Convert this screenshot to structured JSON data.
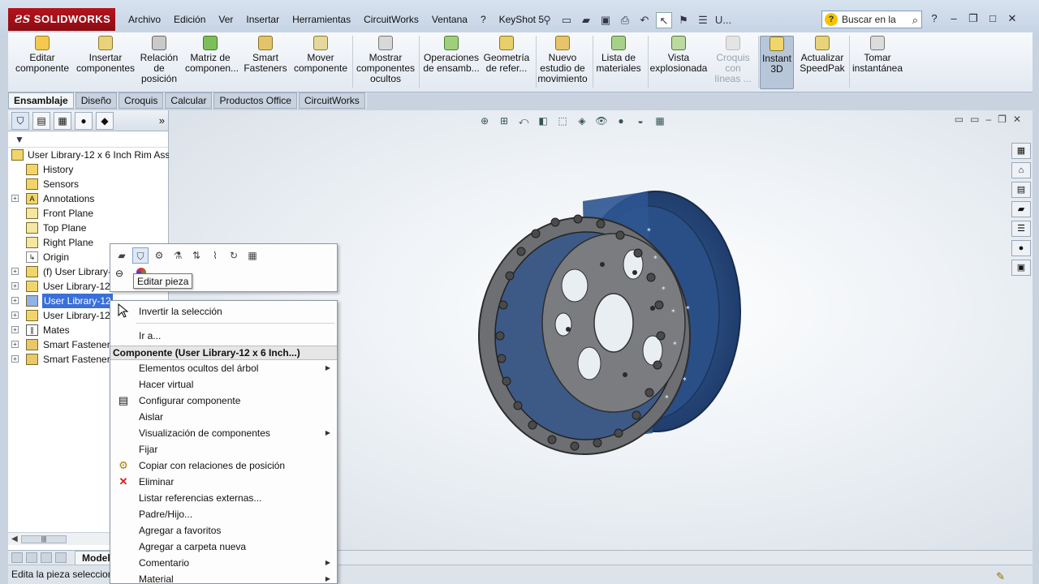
{
  "app": {
    "logo": "SOLIDWORKS",
    "menus": [
      "Archivo",
      "Edición",
      "Ver",
      "Insertar",
      "Herramientas",
      "CircuitWorks",
      "Ventana",
      "?",
      "KeyShot 5"
    ],
    "user_label": "U...",
    "search_placeholder": "Buscar en la"
  },
  "command_manager": [
    {
      "label": "Editar componente",
      "icon": "edit-component-icon"
    },
    {
      "label": "Insertar componentes",
      "icon": "insert-components-icon"
    },
    {
      "label": "Relación de posición",
      "icon": "mate-icon"
    },
    {
      "label": "Matriz de componen...",
      "icon": "component-pattern-icon"
    },
    {
      "label": "Smart Fasteners",
      "icon": "smart-fasteners-icon"
    },
    {
      "label": "Mover componente",
      "icon": "move-component-icon"
    },
    {
      "label": "Mostrar componentes ocultos",
      "icon": "show-hidden-icon"
    },
    {
      "label": "Operaciones de ensamb...",
      "icon": "assembly-features-icon"
    },
    {
      "label": "Geometría de refer...",
      "icon": "reference-geometry-icon"
    },
    {
      "label": "Nuevo estudio de movimiento",
      "icon": "motion-study-icon"
    },
    {
      "label": "Lista de materiales",
      "icon": "bom-icon"
    },
    {
      "label": "Vista explosionada",
      "icon": "exploded-view-icon"
    },
    {
      "label": "Croquis con líneas ...",
      "icon": "explode-line-icon"
    },
    {
      "label": "Instant 3D",
      "icon": "instant3d-icon"
    },
    {
      "label": "Actualizar SpeedPak",
      "icon": "speedpak-icon"
    },
    {
      "label": "Tomar instantánea",
      "icon": "snapshot-icon"
    }
  ],
  "command_tabs": [
    "Ensamblaje",
    "Diseño",
    "Croquis",
    "Calcular",
    "Productos Office",
    "CircuitWorks"
  ],
  "feature_tree": {
    "root": "User Library-12 x 6 Inch Rim Asse",
    "items": [
      {
        "label": "History",
        "icon": "history-icon"
      },
      {
        "label": "Sensors",
        "icon": "sensors-icon"
      },
      {
        "label": "Annotations",
        "icon": "annotations-icon"
      },
      {
        "label": "Front Plane",
        "icon": "plane-icon"
      },
      {
        "label": "Top Plane",
        "icon": "plane-icon"
      },
      {
        "label": "Right Plane",
        "icon": "plane-icon"
      },
      {
        "label": "Origin",
        "icon": "origin-icon"
      },
      {
        "label": "(f) User Library-",
        "icon": "part-icon"
      },
      {
        "label": "User Library-12",
        "icon": "part-icon"
      },
      {
        "label": "User Library-12",
        "icon": "part-icon"
      },
      {
        "label": "User Library-12",
        "icon": "part-icon"
      },
      {
        "label": "Mates",
        "icon": "mates-icon"
      },
      {
        "label": "Smart Fastener1",
        "icon": "folder-icon"
      },
      {
        "label": "Smart Fastener2",
        "icon": "folder-icon"
      }
    ]
  },
  "context_toolbar": {
    "tooltip": "Editar pieza"
  },
  "context_menu": {
    "items_top": [
      {
        "label": "Invertir la selección"
      },
      {
        "label": "Ir a..."
      }
    ],
    "header": "Componente (User Library-12 x 6 Inch...)",
    "items": [
      {
        "label": "Elementos ocultos del árbol",
        "submenu": true
      },
      {
        "label": "Hacer virtual"
      },
      {
        "label": "Configurar componente",
        "icon": "configure-icon"
      },
      {
        "label": "Aislar"
      },
      {
        "label": "Visualización de componentes",
        "submenu": true
      },
      {
        "label": "Fijar"
      },
      {
        "label": "Copiar con relaciones de posición",
        "icon": "copy-mates-icon"
      },
      {
        "label": "Eliminar",
        "icon": "delete-icon"
      },
      {
        "label": "Listar referencias externas..."
      },
      {
        "label": "Padre/Hijo..."
      },
      {
        "label": "Agregar a favoritos"
      },
      {
        "label": "Agregar a carpeta nueva"
      },
      {
        "label": "Comentario",
        "submenu": true
      },
      {
        "label": "Material",
        "submenu": true
      }
    ]
  },
  "bottom": {
    "model_tab": "Modelo",
    "status": "Edita la pieza seleccion"
  },
  "colors": {
    "rim_blue": "#2a4f86",
    "rim_gray": "#6d6f72",
    "selection": "#3a6fd8",
    "brand_red": "#b5121b"
  }
}
